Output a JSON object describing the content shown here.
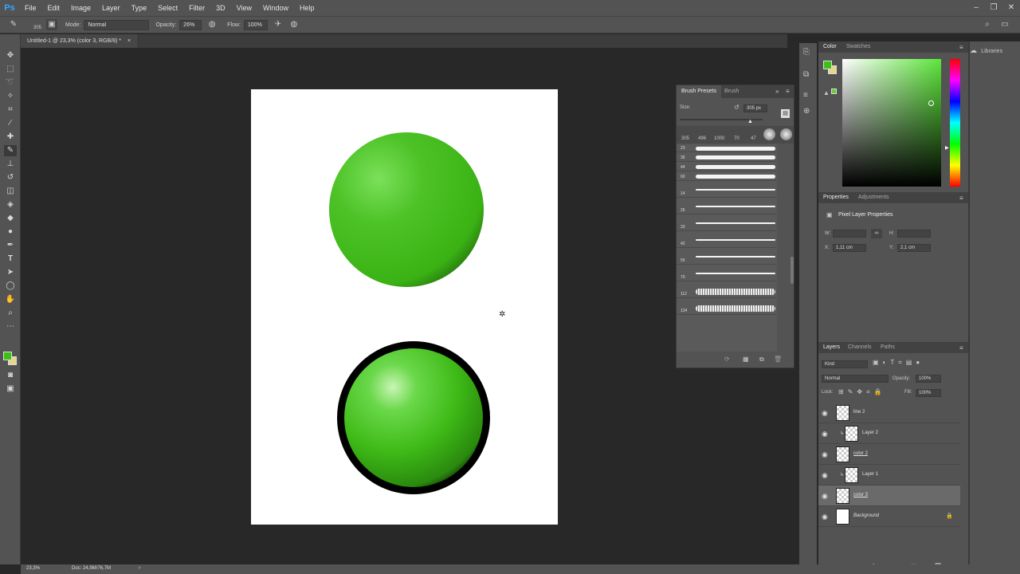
{
  "app": {
    "logo": "Ps"
  },
  "menu": [
    "File",
    "Edit",
    "Image",
    "Layer",
    "Type",
    "Select",
    "Filter",
    "3D",
    "View",
    "Window",
    "Help"
  ],
  "options": {
    "brush_size": "305",
    "mode_label": "Mode:",
    "mode_value": "Normal",
    "opacity_label": "Opacity:",
    "opacity_value": "26%",
    "flow_label": "Flow:",
    "flow_value": "100%"
  },
  "document": {
    "tab_title": "Untitled-1 @ 23,3% (color 3, RGB/8) *"
  },
  "status": {
    "zoom": "23,3%",
    "doc_info": "Doc: 24,9M/76,7M"
  },
  "brush_presets": {
    "tab1": "Brush Presets",
    "tab2": "Brush",
    "size_label": "Size:",
    "size_value": "305 px",
    "recent_sizes": [
      "305",
      "496",
      "1000",
      "70",
      "47"
    ],
    "preset_sizes": [
      "23",
      "36",
      "44",
      "60",
      "14",
      "26",
      "33",
      "42",
      "55",
      "70",
      "112",
      "134"
    ]
  },
  "color_panel": {
    "tab1": "Color",
    "tab2": "Swatches",
    "fg": "#3ec013",
    "bg": "#e8d48a",
    "hue_color": "#5ce63a"
  },
  "libraries": {
    "label": "Libraries"
  },
  "properties": {
    "tab1": "Properties",
    "tab2": "Adjustments",
    "title": "Pixel Layer Properties",
    "w_label": "W:",
    "h_label": "H:",
    "x_label": "X:",
    "x_value": "1,11 cm",
    "y_label": "Y:",
    "y_value": "2,1 cm"
  },
  "layers_panel": {
    "tab1": "Layers",
    "tab2": "Channels",
    "tab3": "Paths",
    "kind_label": "Kind",
    "blend_mode": "Normal",
    "opacity_label": "Opacity:",
    "opacity_value": "100%",
    "lock_label": "Lock:",
    "fill_label": "Fill:",
    "fill_value": "100%",
    "layers": [
      {
        "name": "line 2",
        "selected": false
      },
      {
        "name": "Layer 2",
        "selected": false
      },
      {
        "name": "color 2",
        "selected": false
      },
      {
        "name": "Layer 1",
        "selected": false
      },
      {
        "name": "color 3",
        "selected": true
      },
      {
        "name": "Background",
        "selected": false
      }
    ]
  }
}
